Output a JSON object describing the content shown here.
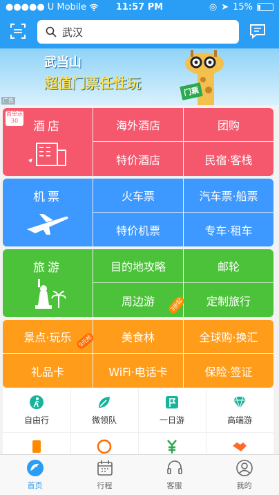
{
  "status": {
    "carrier": "U Mobile",
    "time": "11:57 PM",
    "battery": "15%",
    "battery_level": 0.15
  },
  "header": {
    "search_value": "武汉"
  },
  "banner": {
    "line1": "武当山",
    "line2": "超值门票任性玩",
    "badge": "门票",
    "ad_mark": "广告"
  },
  "colors": {
    "blue": "#2a9df4",
    "hotel": "#f5576c",
    "flight": "#3d98ff",
    "travel": "#4cc23a",
    "misc": "#ff9c1a"
  },
  "grid": {
    "hotel": {
      "main": "酒店",
      "tag": "首单送30",
      "c1": "海外酒店",
      "c2": "团购",
      "c3": "特价酒店",
      "c4": "民宿·客栈"
    },
    "flight": {
      "main": "机票",
      "c1": "火车票",
      "c2": "汽车票·船票",
      "c3": "特价机票",
      "c4": "专车·租车"
    },
    "travel": {
      "main": "旅游",
      "c1": "目的地攻略",
      "c2": "邮轮",
      "c3": "周边游",
      "c3_tag": "3折起",
      "c4": "定制旅行"
    },
    "misc": {
      "c0": "景点·玩乐",
      "c0_tag": "9元抢",
      "c1": "美食林",
      "c2": "全球购·换汇",
      "c3": "礼品卡",
      "c4": "WiFi·电话卡",
      "c5": "保险·签证"
    }
  },
  "quick": [
    {
      "label": "自由行",
      "icon": "walk-icon"
    },
    {
      "label": "微领队",
      "icon": "leaf-icon"
    },
    {
      "label": "一日游",
      "icon": "flag-icon"
    },
    {
      "label": "高端游",
      "icon": "diamond-icon"
    }
  ],
  "tabs": [
    {
      "label": "首页",
      "icon": "home-dolphin-icon"
    },
    {
      "label": "行程",
      "icon": "calendar-icon"
    },
    {
      "label": "客服",
      "icon": "headset-icon"
    },
    {
      "label": "我的",
      "icon": "user-icon"
    }
  ]
}
